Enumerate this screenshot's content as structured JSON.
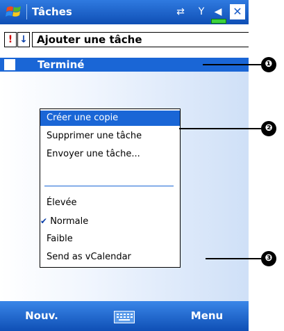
{
  "titlebar": {
    "title": "Tâches",
    "close_label": "✕"
  },
  "entrybar": {
    "priority_label": "!",
    "sort_label": "↓",
    "add_task_text": "Ajouter une tâche"
  },
  "tasks": [
    {
      "label": "Terminé",
      "checked": false
    }
  ],
  "context_menu": {
    "items": [
      {
        "label": "Créer une copie",
        "selected": true
      },
      {
        "label": "Supprimer une tâche"
      },
      {
        "label": "Envoyer une tâche..."
      },
      {
        "label": "Élevée"
      },
      {
        "label": "Normale",
        "checked": true
      },
      {
        "label": "Faible"
      },
      {
        "label": "Send as vCalendar"
      }
    ]
  },
  "bottombar": {
    "left_softkey": "Nouv.",
    "right_softkey": "Menu"
  },
  "callouts": [
    "❶",
    "❷",
    "❸"
  ],
  "colors": {
    "titlebar": "#1b5dc8",
    "selection": "#1a66d6",
    "list_gradient_end": "#cfe0f7"
  }
}
